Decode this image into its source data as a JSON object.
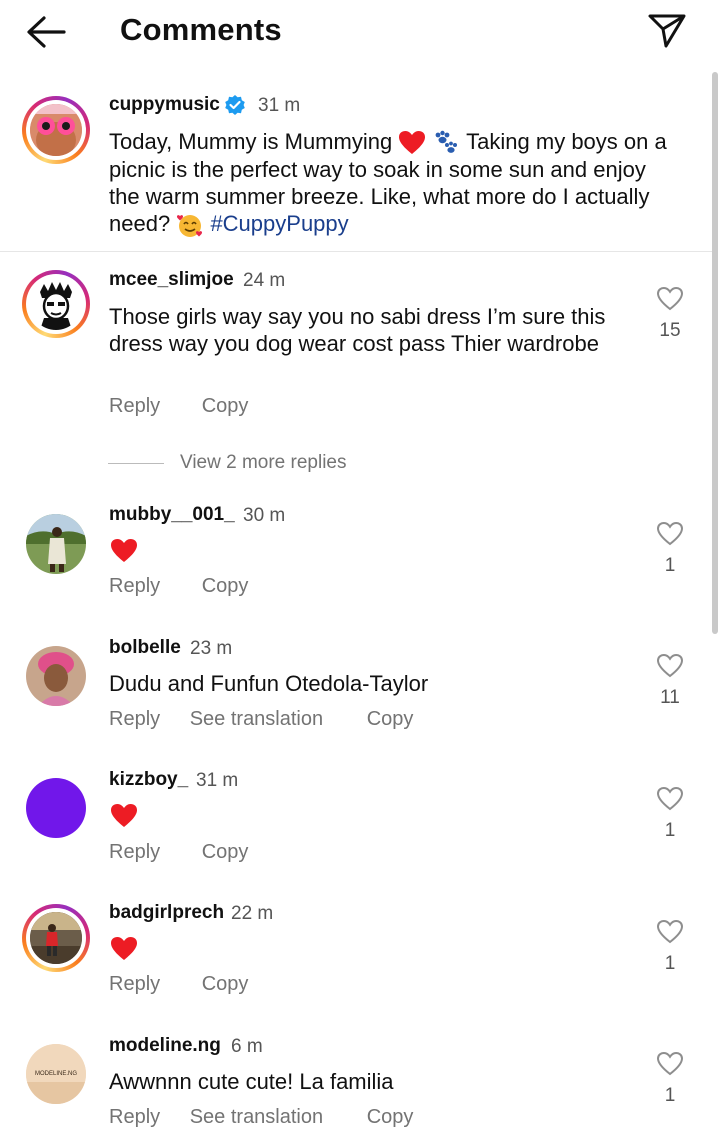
{
  "header": {
    "title": "Comments",
    "back_icon": "arrow-left-icon",
    "send_icon": "paper-plane-icon"
  },
  "post": {
    "username": "cuppymusic",
    "verified": true,
    "time": "31 m",
    "caption_1": "Today, Mummy is Mummying",
    "caption_2": "Taking my boys on a picnic is the perfect way to soak in some sun and enjoy the warm summer breeze. Like, what more do I actually need?",
    "hashtag": "#CuppyPuppy"
  },
  "comments": [
    {
      "username": "mcee_slimjoe",
      "time": "24 m",
      "text": "Those girls way say you no sabi dress I’m sure this dress way you dog wear cost pass Thier wardrobe",
      "likes": "15",
      "reply": "Reply",
      "copy": "Copy"
    },
    {
      "username": "mubby__001_",
      "time": "30 m",
      "text": "",
      "likes": "1",
      "reply": "Reply",
      "copy": "Copy"
    },
    {
      "username": "bolbelle",
      "time": "23 m",
      "text": "Dudu and Funfun Otedola-Taylor",
      "likes": "11",
      "reply": "Reply",
      "see_translation": "See translation",
      "copy": "Copy"
    },
    {
      "username": "kizzboy_",
      "time": "31 m",
      "text": "",
      "likes": "1",
      "reply": "Reply",
      "copy": "Copy"
    },
    {
      "username": "badgirlprech",
      "time": "22 m",
      "text": "",
      "likes": "1",
      "reply": "Reply",
      "copy": "Copy"
    },
    {
      "username": "modeline.ng",
      "time": "6 m",
      "text": "Awwnnn cute cute! La familia",
      "likes": "1",
      "reply": "Reply",
      "see_translation": "See translation",
      "copy": "Copy"
    }
  ],
  "view_more": "View 2 more replies",
  "avatar_texts": {
    "modeline": "MODELINE.NG"
  },
  "colors": {
    "accent_heart": "#ed1c24",
    "hashtag": "#1a3e8c",
    "verified": "#1d9bf0",
    "kizz_avatar": "#7117ea"
  }
}
